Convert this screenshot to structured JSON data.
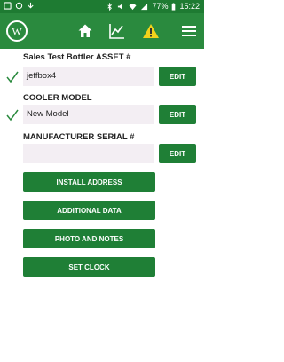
{
  "status_bar": {
    "battery_percent": "77%",
    "time": "15:22"
  },
  "app_bar": {
    "nav_items": [
      "home-icon",
      "chart-icon",
      "warning-icon",
      "menu-icon"
    ]
  },
  "asset_section": {
    "label": "Sales Test Bottler ASSET #",
    "value": "jeffbox4",
    "edit_label": "EDIT"
  },
  "cooler_section": {
    "label": "COOLER MODEL",
    "value": "New Model",
    "edit_label": "EDIT"
  },
  "serial_section": {
    "label": "MANUFACTURER SERIAL #",
    "value": "",
    "edit_label": "EDIT"
  },
  "actions": {
    "install_address": "INSTALL ADDRESS",
    "additional_data": "ADDITIONAL DATA",
    "photo_and_notes": "PHOTO AND NOTES",
    "set_clock": "SET CLOCK"
  },
  "colors": {
    "status_bar": "#1e7b32",
    "app_bar": "#2a8a3e",
    "button": "#1f7f36",
    "field_bg": "#f3eef3",
    "warning": "#f2d21b"
  }
}
